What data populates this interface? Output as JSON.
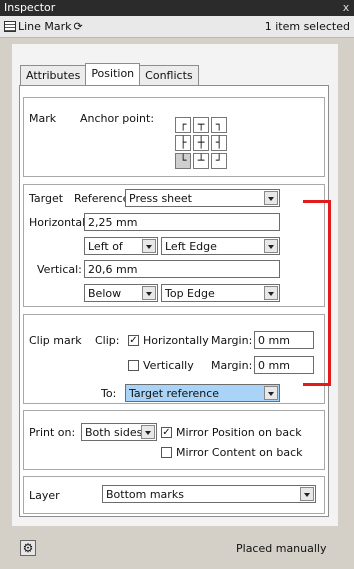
{
  "window": {
    "title": "Inspector",
    "close": "x"
  },
  "toolbar": {
    "mark_type": "Line Mark",
    "selection_status": "1 item selected"
  },
  "tabs": [
    {
      "label": "Attributes"
    },
    {
      "label": "Position",
      "active": true
    },
    {
      "label": "Conflicts"
    }
  ],
  "mark": {
    "label": "Mark",
    "anchor_label": "Anchor point:",
    "selected_anchor": "bottom-left"
  },
  "target": {
    "label": "Target",
    "reference_label": "Reference:",
    "reference_value": "Press sheet",
    "horizontal_label": "Horizontal:",
    "horizontal_value": "2,25 mm",
    "horizontal_rel": "Left of",
    "horizontal_edge": "Left Edge",
    "vertical_label": "Vertical:",
    "vertical_value": "20,6 mm",
    "vertical_rel": "Below",
    "vertical_edge": "Top Edge"
  },
  "clip": {
    "label": "Clip mark",
    "clip_label": "Clip:",
    "horizontally": "Horizontally",
    "horizontally_checked": true,
    "vertically": "Vertically",
    "vertically_checked": false,
    "margin_label": "Margin:",
    "margin_h": "0 mm",
    "margin_v": "0 mm",
    "to_label": "To:",
    "to_value": "Target reference"
  },
  "print": {
    "label": "Print on:",
    "value": "Both sides",
    "mirror_position": "Mirror Position on back",
    "mirror_position_checked": true,
    "mirror_content": "Mirror Content on back",
    "mirror_content_checked": false
  },
  "layer": {
    "label": "Layer",
    "value": "Bottom marks"
  },
  "footer": {
    "status": "Placed manually"
  },
  "colors": {
    "highlight": "#a9d4f7",
    "annotation": "#e21b1b"
  }
}
